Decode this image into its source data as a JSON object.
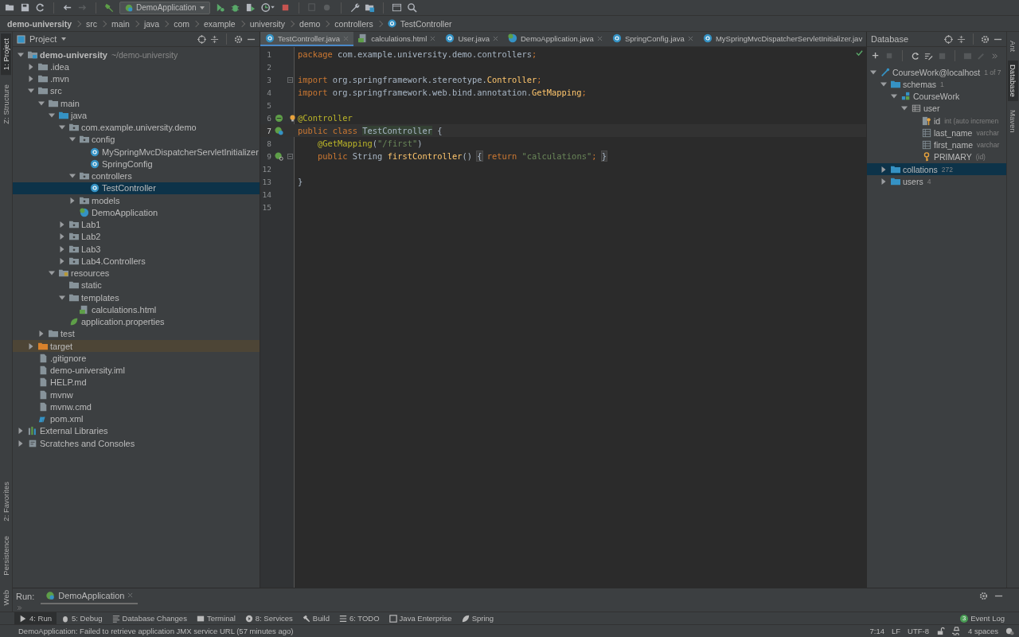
{
  "toolbar": {
    "run_config": "DemoApplication"
  },
  "breadcrumbs": [
    {
      "label": "demo-university",
      "kind": "root"
    },
    {
      "label": "src",
      "kind": "folder"
    },
    {
      "label": "main",
      "kind": "folder"
    },
    {
      "label": "java",
      "kind": "folder"
    },
    {
      "label": "com",
      "kind": "folder"
    },
    {
      "label": "example",
      "kind": "folder"
    },
    {
      "label": "university",
      "kind": "folder"
    },
    {
      "label": "demo",
      "kind": "folder"
    },
    {
      "label": "controllers",
      "kind": "folder"
    },
    {
      "label": "TestController",
      "kind": "class"
    }
  ],
  "left_strip": {
    "top": [
      {
        "label": "1: Project",
        "selected": true
      },
      {
        "label": "Z: Structure",
        "selected": false
      }
    ],
    "bottom": [
      {
        "label": "2: Favorites",
        "selected": false
      },
      {
        "label": "Persistence",
        "selected": false
      },
      {
        "label": "Web",
        "selected": false
      }
    ]
  },
  "project_panel": {
    "title": "Project"
  },
  "project_tree": [
    {
      "label": "demo-university",
      "hint": "~/demo-university",
      "kind": "module",
      "expanded": true,
      "selected": false,
      "children": [
        {
          "label": ".idea",
          "kind": "folder",
          "expanded": false,
          "selected": false
        },
        {
          "label": ".mvn",
          "kind": "folder",
          "expanded": false,
          "selected": false
        },
        {
          "label": "src",
          "kind": "folder",
          "expanded": true,
          "selected": false,
          "children": [
            {
              "label": "main",
              "kind": "folder",
              "expanded": true,
              "selected": false,
              "children": [
                {
                  "label": "java",
                  "kind": "source",
                  "expanded": true,
                  "selected": false,
                  "children": [
                    {
                      "label": "com.example.university.demo",
                      "kind": "package",
                      "expanded": true,
                      "selected": false,
                      "children": [
                        {
                          "label": "config",
                          "kind": "package",
                          "expanded": true,
                          "selected": false,
                          "children": [
                            {
                              "label": "MySpringMvcDispatcherServletInitializer",
                              "kind": "class",
                              "selected": false
                            },
                            {
                              "label": "SpringConfig",
                              "kind": "class",
                              "selected": false
                            }
                          ]
                        },
                        {
                          "label": "controllers",
                          "kind": "package",
                          "expanded": true,
                          "selected": false,
                          "children": [
                            {
                              "label": "TestController",
                              "kind": "class",
                              "selected": true
                            }
                          ]
                        },
                        {
                          "label": "models",
                          "kind": "package",
                          "expanded": false,
                          "selected": false
                        },
                        {
                          "label": "DemoApplication",
                          "kind": "spring",
                          "selected": false
                        }
                      ]
                    },
                    {
                      "label": "Lab1",
                      "kind": "package",
                      "expanded": false,
                      "selected": false
                    },
                    {
                      "label": "Lab2",
                      "kind": "package",
                      "expanded": false,
                      "selected": false
                    },
                    {
                      "label": "Lab3",
                      "kind": "package",
                      "expanded": false,
                      "selected": false
                    },
                    {
                      "label": "Lab4.Controllers",
                      "kind": "package",
                      "expanded": false,
                      "selected": false
                    }
                  ]
                },
                {
                  "label": "resources",
                  "kind": "resources",
                  "expanded": true,
                  "selected": false,
                  "children": [
                    {
                      "label": "static",
                      "kind": "folder",
                      "selected": false
                    },
                    {
                      "label": "templates",
                      "kind": "folder",
                      "expanded": true,
                      "selected": false,
                      "children": [
                        {
                          "label": "calculations.html",
                          "kind": "html",
                          "selected": false
                        }
                      ]
                    },
                    {
                      "label": "application.properties",
                      "kind": "properties",
                      "selected": false
                    }
                  ]
                }
              ]
            },
            {
              "label": "test",
              "kind": "folder",
              "expanded": false,
              "selected": false
            }
          ]
        },
        {
          "label": "target",
          "kind": "folder",
          "expanded": false,
          "selected": false,
          "excluded": true
        },
        {
          "label": ".gitignore",
          "kind": "file",
          "selected": false
        },
        {
          "label": "demo-university.iml",
          "kind": "file",
          "selected": false
        },
        {
          "label": "HELP.md",
          "kind": "file",
          "selected": false
        },
        {
          "label": "mvnw",
          "kind": "file",
          "selected": false
        },
        {
          "label": "mvnw.cmd",
          "kind": "file",
          "selected": false
        },
        {
          "label": "pom.xml",
          "kind": "maven",
          "selected": false
        }
      ]
    },
    {
      "label": "External Libraries",
      "kind": "libraries",
      "expanded": false,
      "selected": false
    },
    {
      "label": "Scratches and Consoles",
      "kind": "scratches",
      "expanded": false,
      "selected": false
    }
  ],
  "editor_tabs": [
    {
      "label": "TestController.java",
      "kind": "class",
      "selected": true
    },
    {
      "label": "calculations.html",
      "kind": "html",
      "selected": false
    },
    {
      "label": "User.java",
      "kind": "class",
      "selected": false
    },
    {
      "label": "DemoApplication.java",
      "kind": "spring",
      "selected": false
    },
    {
      "label": "SpringConfig.java",
      "kind": "class",
      "selected": false
    },
    {
      "label": "MySpringMvcDispatcherServletInitializer.jav",
      "kind": "class",
      "selected": false
    }
  ],
  "code_lines": [
    {
      "number": "1",
      "current": false,
      "kind": "plain",
      "fold": false,
      "tokens": [
        {
          "text": "package",
          "kind": "keyword"
        },
        {
          "text": " com.example.university.demo.controllers",
          "kind": "plain"
        },
        {
          "text": ";",
          "kind": "keyword"
        }
      ]
    },
    {
      "number": "2",
      "current": false,
      "kind": "plain",
      "fold": false
    },
    {
      "number": "3",
      "current": false,
      "kind": "plain",
      "fold": true,
      "tokens": [
        {
          "text": "import",
          "kind": "keyword"
        },
        {
          "text": " org.springframework.stereotype.",
          "kind": "plain"
        },
        {
          "text": "Controller",
          "kind": "method"
        },
        {
          "text": ";",
          "kind": "keyword"
        }
      ]
    },
    {
      "number": "4",
      "current": false,
      "kind": "plain",
      "fold": false,
      "tokens": [
        {
          "text": "import",
          "kind": "keyword"
        },
        {
          "text": " org.springframework.web.bind.annotation.",
          "kind": "plain"
        },
        {
          "text": "GetMapping",
          "kind": "method"
        },
        {
          "text": ";",
          "kind": "keyword"
        }
      ]
    },
    {
      "number": "5",
      "current": false,
      "kind": "plain",
      "fold": false
    },
    {
      "number": "6",
      "current": false,
      "kind": "bean",
      "fold": false,
      "tokens": [
        {
          "text": "@Controller",
          "kind": "annotation"
        }
      ]
    },
    {
      "number": "7",
      "current": true,
      "kind": "bean-class",
      "fold": false,
      "tokens": [
        {
          "text": "public class ",
          "kind": "keyword"
        },
        {
          "text": "TestController",
          "kind": "highlight"
        },
        {
          "text": " {",
          "kind": "plain"
        }
      ]
    },
    {
      "number": "8",
      "current": false,
      "kind": "plain",
      "fold": false,
      "tokens": [
        {
          "text": "    @GetMapping",
          "kind": "annotation"
        },
        {
          "text": "(",
          "kind": "plain"
        },
        {
          "text": "\"/first\"",
          "kind": "string"
        },
        {
          "text": ")",
          "kind": "plain"
        }
      ]
    },
    {
      "number": "9",
      "current": false,
      "kind": "bean-mapping",
      "fold": true,
      "tokens": [
        {
          "text": "    public ",
          "kind": "keyword"
        },
        {
          "text": "String ",
          "kind": "plain"
        },
        {
          "text": "firstController",
          "kind": "method"
        },
        {
          "text": "() ",
          "kind": "plain"
        },
        {
          "text": "{",
          "kind": "fold"
        },
        {
          "text": " return ",
          "kind": "keyword"
        },
        {
          "text": "\"calculations\"",
          "kind": "string"
        },
        {
          "text": "; ",
          "kind": "keyword"
        },
        {
          "text": "}",
          "kind": "fold"
        }
      ]
    },
    {
      "number": "12",
      "current": false,
      "kind": "plain",
      "fold": false
    },
    {
      "number": "13",
      "current": false,
      "kind": "plain",
      "fold": false,
      "tokens": [
        {
          "text": "}",
          "kind": "plain"
        }
      ]
    },
    {
      "number": "14",
      "current": false,
      "kind": "plain",
      "fold": false
    },
    {
      "number": "15",
      "current": false,
      "kind": "plain",
      "fold": false
    }
  ],
  "database_panel": {
    "title": "Database"
  },
  "database_tree": [
    {
      "label": "CourseWork@localhost",
      "hint": "1 of 7",
      "kind": "datasource",
      "expanded": true,
      "selected": false,
      "children": [
        {
          "label": "schemas",
          "hint": "1",
          "kind": "folder",
          "expanded": true,
          "selected": false,
          "children": [
            {
              "label": "CourseWork",
              "kind": "schema",
              "expanded": true,
              "selected": false,
              "children": [
                {
                  "label": "user",
                  "kind": "table",
                  "expanded": true,
                  "selected": false,
                  "children": [
                    {
                      "label": "id",
                      "hint": "int (auto incremen",
                      "kind": "key-column",
                      "selected": false
                    },
                    {
                      "label": "last_name",
                      "hint": "varchar",
                      "kind": "column",
                      "selected": false
                    },
                    {
                      "label": "first_name",
                      "hint": "varchar",
                      "kind": "column",
                      "selected": false
                    },
                    {
                      "label": "PRIMARY",
                      "hint": "(id)",
                      "kind": "key",
                      "selected": false
                    }
                  ]
                }
              ]
            }
          ]
        },
        {
          "label": "collations",
          "hint": "272",
          "kind": "folder",
          "expanded": false,
          "selected": true
        },
        {
          "label": "users",
          "hint": "4",
          "kind": "folder",
          "expanded": false,
          "selected": false
        }
      ]
    }
  ],
  "right_strip": [
    {
      "label": "Ant",
      "selected": false
    },
    {
      "label": "Database",
      "selected": true
    },
    {
      "label": "Maven",
      "selected": false
    }
  ],
  "run_panel": {
    "title": "Run:",
    "tab": "DemoApplication"
  },
  "tool_windows": [
    {
      "label": "4: Run",
      "kind": "run",
      "selected": true
    },
    {
      "label": "5: Debug",
      "kind": "debug",
      "selected": false
    },
    {
      "label": "Database Changes",
      "kind": "changes",
      "selected": false
    },
    {
      "label": "Terminal",
      "kind": "terminal",
      "selected": false
    },
    {
      "label": "8: Services",
      "kind": "services",
      "selected": false
    },
    {
      "label": "Build",
      "kind": "build",
      "selected": false
    },
    {
      "label": "6: TODO",
      "kind": "todo",
      "selected": false
    },
    {
      "label": "Java Enterprise",
      "kind": "enterprise",
      "selected": false
    },
    {
      "label": "Spring",
      "kind": "spring",
      "selected": false
    }
  ],
  "event_log": {
    "label": "Event Log",
    "count": "3"
  },
  "status_bar": {
    "message": "DemoApplication: Failed to retrieve application JMX service URL (57 minutes ago)",
    "position": "7:14",
    "line_separator": "LF",
    "encoding": "UTF-8",
    "indent": "4 spaces"
  }
}
